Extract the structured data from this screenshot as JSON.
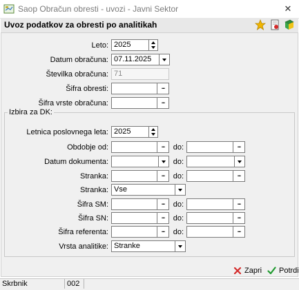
{
  "window": {
    "title": "Saop Obračun obresti - uvozi - Javni Sektor"
  },
  "header": {
    "title": "Uvoz podatkov za obresti po analitikah"
  },
  "form": {
    "leto": {
      "label": "Leto:",
      "value": "2025"
    },
    "datum_obracuna": {
      "label": "Datum obračuna:",
      "value": "07.11.2025"
    },
    "stevilka_obracuna": {
      "label": "Številka obračuna:",
      "value": "71"
    },
    "sifra_obresti": {
      "label": "Šifra obresti:",
      "value": ""
    },
    "sifra_vrste_obracuna": {
      "label": "Šifra vrste obračuna:",
      "value": ""
    }
  },
  "group": {
    "title": "Izbira za DK:",
    "do_label": "do:",
    "letnica": {
      "label": "Letnica poslovnega leta:",
      "value": "2025"
    },
    "obdobje": {
      "label": "Obdobje od:",
      "from": "",
      "to": ""
    },
    "datum_dokumenta": {
      "label": "Datum dokumenta:",
      "from": "",
      "to": ""
    },
    "stranka_range": {
      "label": "Stranka:",
      "from": "",
      "to": ""
    },
    "stranka_select": {
      "label": "Stranka:",
      "value": "Vse"
    },
    "sifra_sm": {
      "label": "Šifra SM:",
      "from": "",
      "to": ""
    },
    "sifra_sn": {
      "label": "Šifra SN:",
      "from": "",
      "to": ""
    },
    "sifra_referenta": {
      "label": "Šifra referenta:",
      "from": "",
      "to": ""
    },
    "vrsta_analitike": {
      "label": "Vrsta analitike:",
      "value": "Stranke"
    }
  },
  "actions": {
    "cancel_label": "Zapri",
    "confirm_label": "Potrdi"
  },
  "statusbar": {
    "user": "Skrbnik",
    "code": "002"
  },
  "colors": {
    "cancel_icon": "#d42a2a",
    "confirm_icon": "#1f9a2f",
    "star_icon": "#f2b600"
  }
}
